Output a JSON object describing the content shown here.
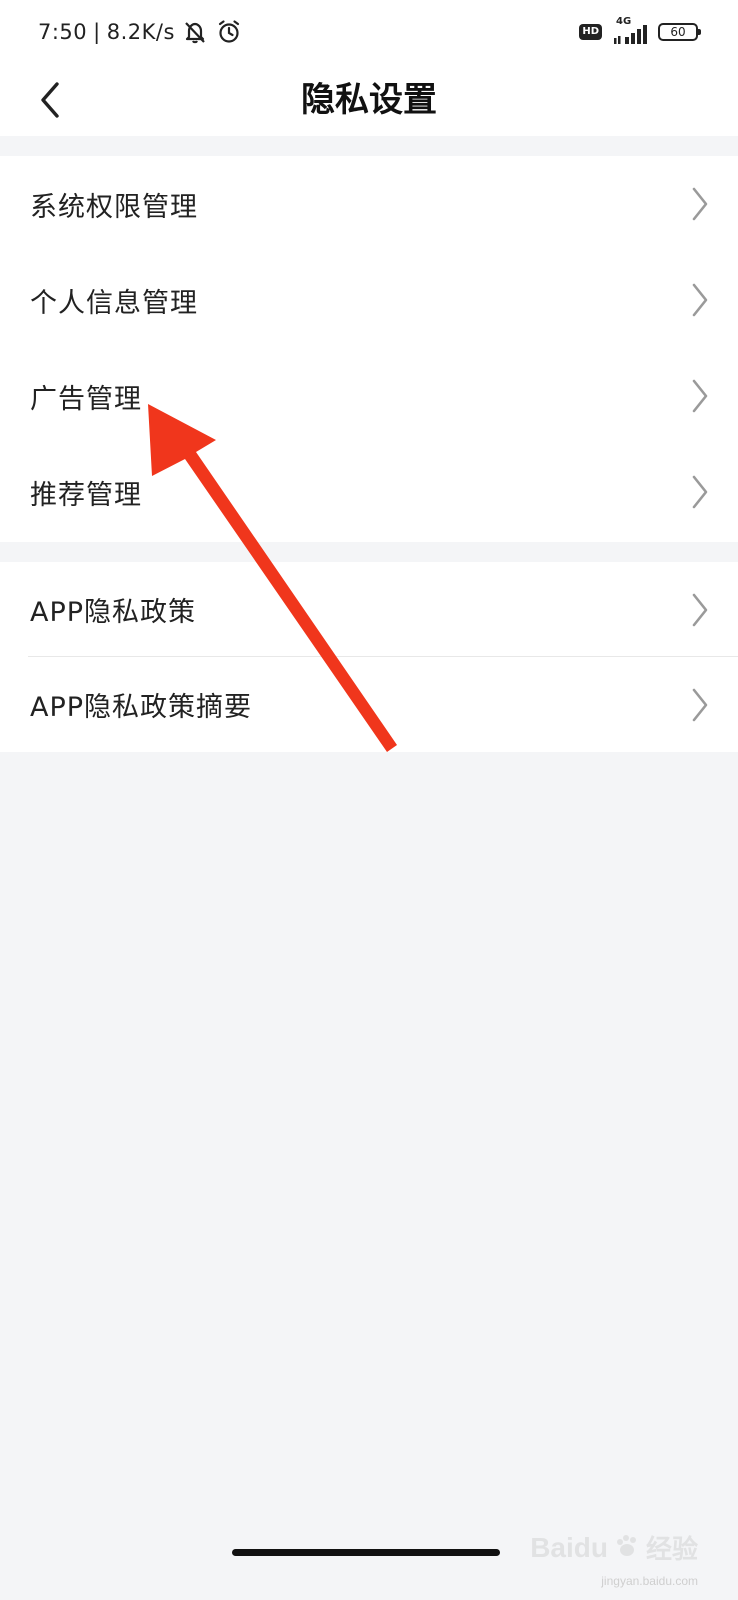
{
  "status_bar": {
    "time": "7:50",
    "separator": "|",
    "net_speed": "8.2K/s",
    "network_type": "4G",
    "hd_label": "HD",
    "battery_level": "60"
  },
  "nav": {
    "title": "隐私设置"
  },
  "groups": [
    {
      "items": [
        {
          "label": "系统权限管理"
        },
        {
          "label": "个人信息管理"
        },
        {
          "label": "广告管理"
        },
        {
          "label": "推荐管理"
        }
      ]
    },
    {
      "items": [
        {
          "label": "APP隐私政策"
        },
        {
          "label": "APP隐私政策摘要"
        }
      ]
    }
  ],
  "annotation": {
    "color": "#f0361c",
    "target": "广告管理"
  },
  "watermark": {
    "brand": "Baidu",
    "sub": "经验",
    "url": "jingyan.baidu.com"
  }
}
